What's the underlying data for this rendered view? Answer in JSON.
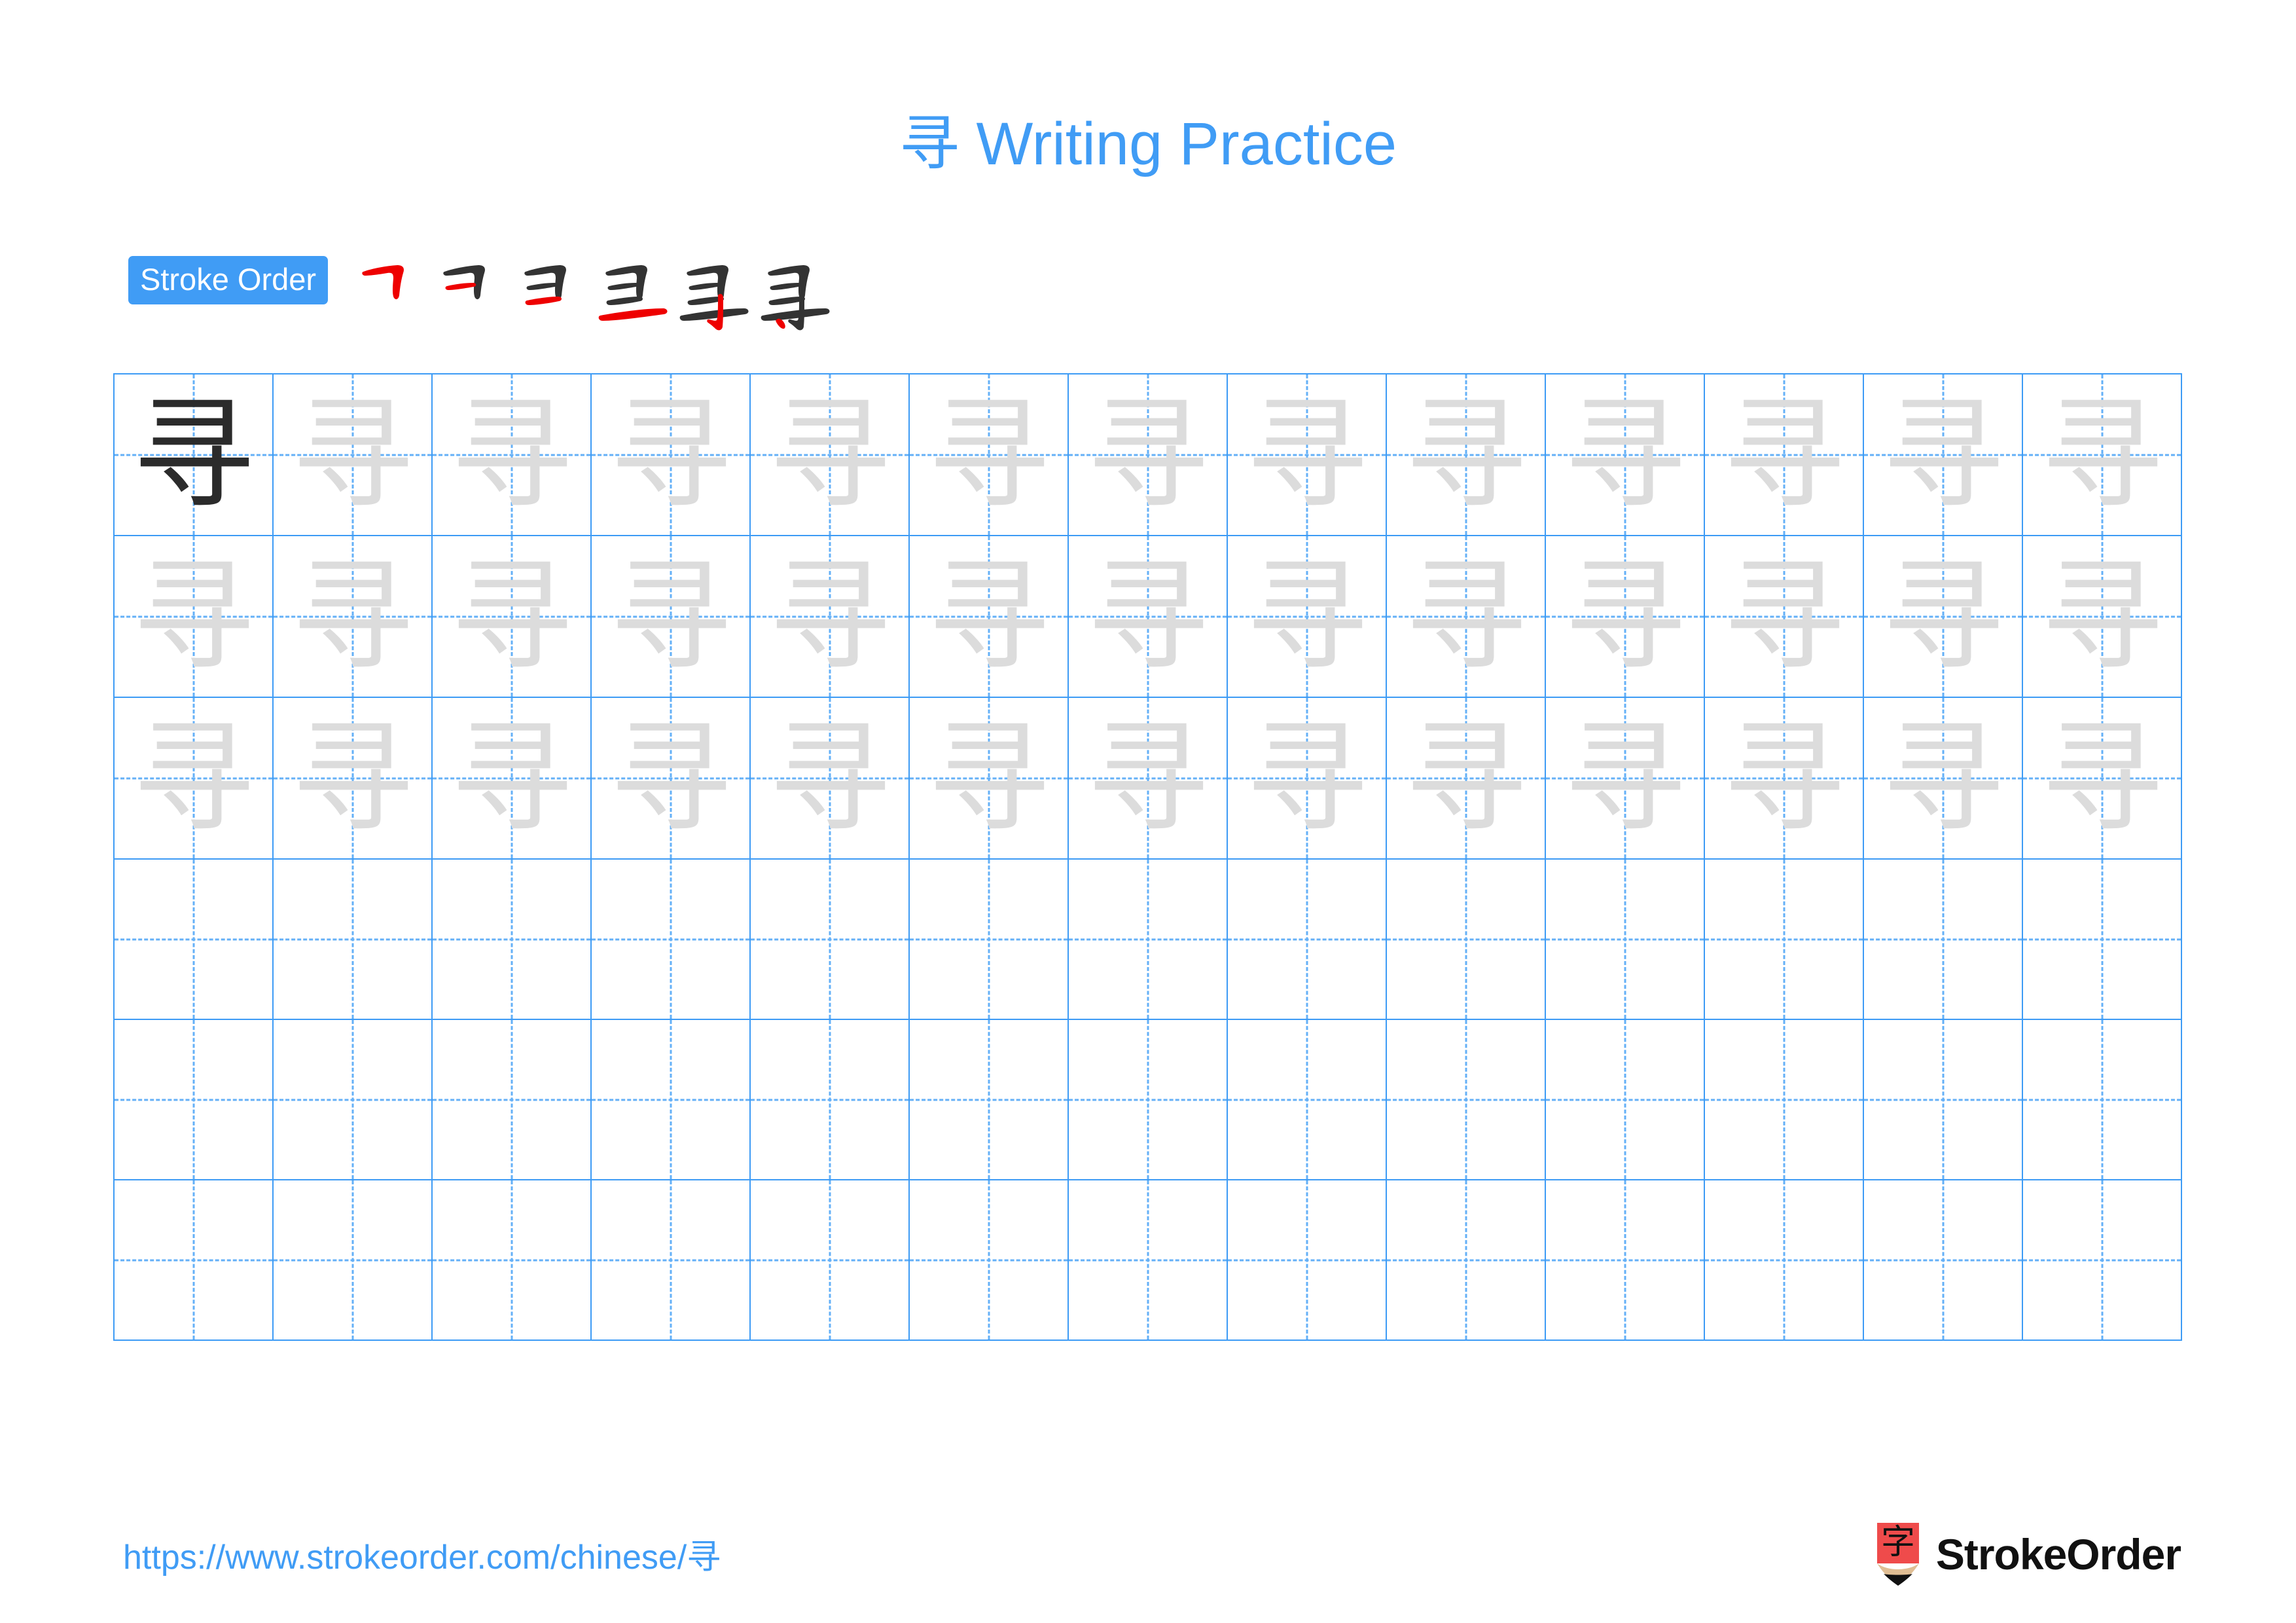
{
  "character": "寻",
  "title": {
    "text": "寻 Writing Practice",
    "character": "寻",
    "suffix": " Writing Practice",
    "color": "#409cf5"
  },
  "stroke_order": {
    "badge_label": "Stroke Order",
    "badge_bg": "#409cf5",
    "badge_text_color": "#ffffff",
    "total_strokes": 6,
    "existing_stroke_color": "#333333",
    "new_stroke_color": "#ee0000",
    "steps": [
      {
        "index": 1,
        "new_stroke": "heng-zhe",
        "strokes_shown": 1
      },
      {
        "index": 2,
        "new_stroke": "heng",
        "strokes_shown": 2
      },
      {
        "index": 3,
        "new_stroke": "heng",
        "strokes_shown": 3
      },
      {
        "index": 4,
        "new_stroke": "heng",
        "strokes_shown": 4
      },
      {
        "index": 5,
        "new_stroke": "shu-gou",
        "strokes_shown": 5
      },
      {
        "index": 6,
        "new_stroke": "dian",
        "strokes_shown": 6
      }
    ]
  },
  "grid": {
    "columns": 13,
    "rows": 6,
    "border_color": "#3d9bf5",
    "guide_color": "#64b0f7",
    "solid_char_color": "#2b2b2b",
    "ghost_char_color": "#dcdcdc",
    "cells": [
      [
        "寻",
        "寻",
        "寻",
        "寻",
        "寻",
        "寻",
        "寻",
        "寻",
        "寻",
        "寻",
        "寻",
        "寻",
        "寻"
      ],
      [
        "寻",
        "寻",
        "寻",
        "寻",
        "寻",
        "寻",
        "寻",
        "寻",
        "寻",
        "寻",
        "寻",
        "寻",
        "寻"
      ],
      [
        "寻",
        "寻",
        "寻",
        "寻",
        "寻",
        "寻",
        "寻",
        "寻",
        "寻",
        "寻",
        "寻",
        "寻",
        "寻"
      ],
      [
        "",
        "",
        "",
        "",
        "",
        "",
        "",
        "",
        "",
        "",
        "",
        "",
        ""
      ],
      [
        "",
        "",
        "",
        "",
        "",
        "",
        "",
        "",
        "",
        "",
        "",
        "",
        ""
      ],
      [
        "",
        "",
        "",
        "",
        "",
        "",
        "",
        "",
        "",
        "",
        "",
        "",
        ""
      ]
    ],
    "cell_styles": [
      [
        "solid",
        "ghost",
        "ghost",
        "ghost",
        "ghost",
        "ghost",
        "ghost",
        "ghost",
        "ghost",
        "ghost",
        "ghost",
        "ghost",
        "ghost"
      ],
      [
        "ghost",
        "ghost",
        "ghost",
        "ghost",
        "ghost",
        "ghost",
        "ghost",
        "ghost",
        "ghost",
        "ghost",
        "ghost",
        "ghost",
        "ghost"
      ],
      [
        "ghost",
        "ghost",
        "ghost",
        "ghost",
        "ghost",
        "ghost",
        "ghost",
        "ghost",
        "ghost",
        "ghost",
        "ghost",
        "ghost",
        "ghost"
      ],
      [
        "blank",
        "blank",
        "blank",
        "blank",
        "blank",
        "blank",
        "blank",
        "blank",
        "blank",
        "blank",
        "blank",
        "blank",
        "blank"
      ],
      [
        "blank",
        "blank",
        "blank",
        "blank",
        "blank",
        "blank",
        "blank",
        "blank",
        "blank",
        "blank",
        "blank",
        "blank",
        "blank"
      ],
      [
        "blank",
        "blank",
        "blank",
        "blank",
        "blank",
        "blank",
        "blank",
        "blank",
        "blank",
        "blank",
        "blank",
        "blank",
        "blank"
      ]
    ]
  },
  "footer": {
    "url": "https://www.strokeorder.com/chinese/寻",
    "url_color": "#409cf5",
    "brand_name": "StrokeOrder",
    "logo": {
      "icon_name": "pencil-logo-icon",
      "glyph": "字",
      "body_color": "#ef4b4b",
      "wood_color": "#e0be94",
      "tip_color": "#111111"
    }
  }
}
